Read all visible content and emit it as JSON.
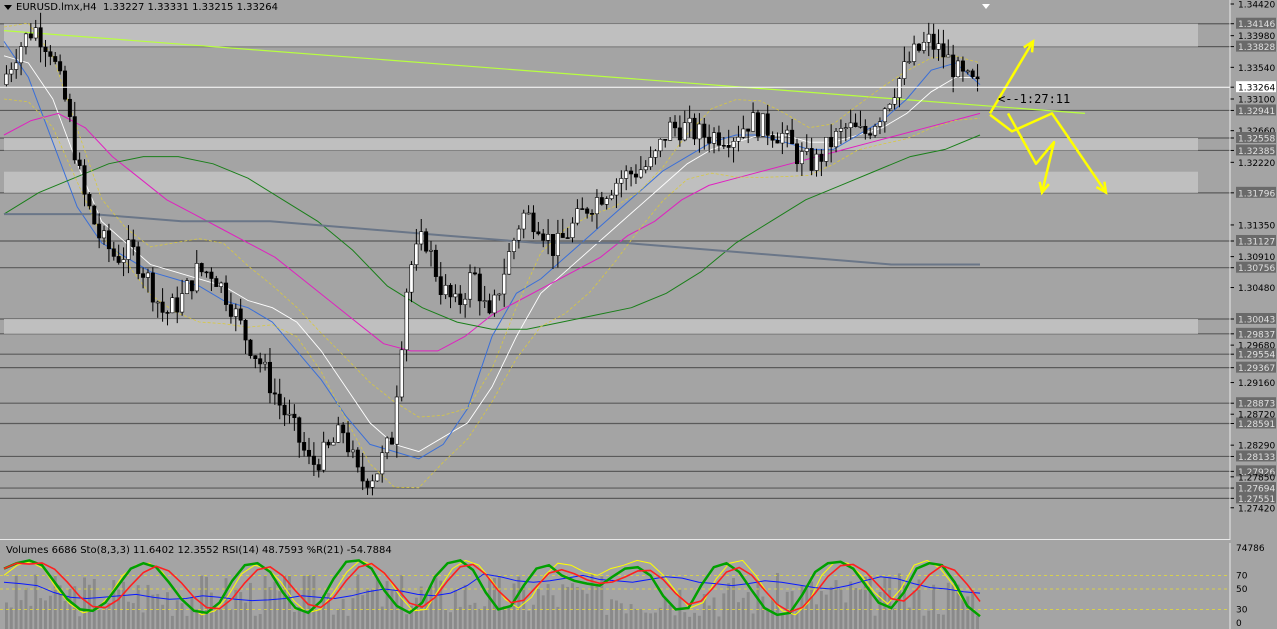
{
  "header": {
    "symbol": "EURUSD.lmx,H4",
    "quote": "1.33227 1.33331 1.33215 1.33264"
  },
  "countdown": "<--1:27:11",
  "current_price": "1.33264",
  "indicators_label": "Volumes 6686  Sto(8,3,3) 11.6402 12.3552  RSI(14) 48.7593  %R(21) -54.7884",
  "colors": {
    "background": "#a4a4a4",
    "bull_candle": "#ffffff",
    "bear_candle": "#000000",
    "ma_fast_white": "#ffffff",
    "ma_blue": "#3a6fd8",
    "ma_magenta": "#e020c0",
    "ma_green": "#1a7f1a",
    "ma_slow_gray": "#6a7688",
    "bollinger": "#d8c840",
    "trendline": "#b8ff40",
    "arrows": "#ffff00",
    "stoch_main": "#00a000",
    "stoch_signal": "#ff2020",
    "rsi": "#0a1aff",
    "williams": "#ffff00"
  },
  "chart_data": [
    {
      "type": "line",
      "title": "EURUSD.lmx,H4",
      "series_kind": "candlestick",
      "ylim": [
        1.27,
        1.3442
      ],
      "y_axis_labels": [
        "1.34420",
        "1.34146",
        "1.33980",
        "1.33828",
        "1.33540",
        "1.33264",
        "1.33100",
        "1.32941",
        "1.32660",
        "1.32558",
        "1.32385",
        "1.32220",
        "1.31796",
        "1.31350",
        "1.31127",
        "1.30910",
        "1.30756",
        "1.30480",
        "1.30043",
        "1.29837",
        "1.29680",
        "1.29554",
        "1.29367",
        "1.29160",
        "1.28873",
        "1.28720",
        "1.28591",
        "1.28290",
        "1.28133",
        "1.27926",
        "1.27850",
        "1.27694",
        "1.27551",
        "1.27420"
      ],
      "horizontal_levels": [
        1.34146,
        1.33828,
        1.32941,
        1.32558,
        1.32385,
        1.31796,
        1.31127,
        1.30756,
        1.30043,
        1.29837,
        1.29554,
        1.29367,
        1.28873,
        1.28591,
        1.28133,
        1.27926,
        1.27694,
        1.27551
      ],
      "shaded_zones": [
        [
          1.33828,
          1.34146
        ],
        [
          1.32385,
          1.32558
        ],
        [
          1.31796,
          1.3209
        ],
        [
          1.29837,
          1.30043
        ]
      ],
      "key_path": [
        1.333,
        1.338,
        1.341,
        1.338,
        1.33,
        1.318,
        1.312,
        1.309,
        1.31,
        1.306,
        1.301,
        1.303,
        1.307,
        1.307,
        1.303,
        1.298,
        1.294,
        1.289,
        1.285,
        1.28,
        1.282,
        1.285,
        1.278,
        1.279,
        1.284,
        1.307,
        1.312,
        1.305,
        1.302,
        1.307,
        1.3,
        1.308,
        1.315,
        1.314,
        1.31,
        1.313,
        1.316,
        1.318,
        1.32,
        1.321,
        1.322,
        1.327,
        1.327,
        1.326,
        1.326,
        1.326,
        1.328,
        1.327,
        1.326,
        1.323,
        1.322,
        1.325,
        1.327,
        1.326,
        1.329,
        1.333,
        1.337,
        1.339,
        1.337,
        1.334,
        1.3326
      ],
      "moving_averages": [
        {
          "name": "MA white",
          "values": [
            1.337,
            1.336,
            1.331,
            1.322,
            1.314,
            1.311,
            1.308,
            1.307,
            1.306,
            1.305,
            1.303,
            1.302,
            1.3,
            1.296,
            1.291,
            1.286,
            1.283,
            1.282,
            1.284,
            1.286,
            1.291,
            1.298,
            1.304,
            1.307,
            1.31,
            1.313,
            1.316,
            1.319,
            1.322,
            1.324,
            1.325,
            1.326,
            1.326,
            1.325,
            1.325,
            1.326,
            1.327,
            1.329,
            1.332,
            1.334,
            1.334
          ]
        },
        {
          "name": "MA blue",
          "values": [
            1.339,
            1.334,
            1.325,
            1.316,
            1.311,
            1.309,
            1.307,
            1.306,
            1.305,
            1.303,
            1.302,
            1.3,
            1.296,
            1.292,
            1.287,
            1.283,
            1.282,
            1.281,
            1.283,
            1.288,
            1.298,
            1.304,
            1.306,
            1.309,
            1.312,
            1.315,
            1.318,
            1.321,
            1.323,
            1.325,
            1.326,
            1.326,
            1.325,
            1.324,
            1.324,
            1.326,
            1.328,
            1.331,
            1.335,
            1.336,
            1.333
          ]
        },
        {
          "name": "MA magenta",
          "values": [
            1.326,
            1.328,
            1.329,
            1.327,
            1.323,
            1.32,
            1.317,
            1.315,
            1.313,
            1.311,
            1.309,
            1.306,
            1.303,
            1.3,
            1.297,
            1.296,
            1.296,
            1.298,
            1.301,
            1.303,
            1.305,
            1.307,
            1.309,
            1.312,
            1.314,
            1.317,
            1.319,
            1.32,
            1.321,
            1.322,
            1.323,
            1.324,
            1.325,
            1.326,
            1.327,
            1.328,
            1.329
          ]
        },
        {
          "name": "MA green",
          "values": [
            1.315,
            1.318,
            1.32,
            1.322,
            1.323,
            1.323,
            1.322,
            1.32,
            1.317,
            1.314,
            1.31,
            1.305,
            1.302,
            1.3,
            1.299,
            1.299,
            1.3,
            1.301,
            1.302,
            1.304,
            1.307,
            1.311,
            1.314,
            1.317,
            1.319,
            1.321,
            1.323,
            1.324,
            1.326
          ]
        },
        {
          "name": "MA gray",
          "values": [
            1.315,
            1.315,
            1.314,
            1.314,
            1.313,
            1.312,
            1.311,
            1.311,
            1.31,
            1.309,
            1.308,
            1.308
          ]
        }
      ],
      "trendline": {
        "from": [
          0,
          1.3405
        ],
        "to": [
          1,
          1.329
        ]
      },
      "projection_arrows": [
        {
          "points": [
            1.329,
            1.339
          ]
        },
        {
          "points": [
            1.329,
            1.322,
            1.325,
            1.318
          ]
        },
        {
          "points": [
            1.3288,
            1.3265,
            1.329,
            1.318
          ]
        }
      ]
    },
    {
      "type": "line",
      "title": "Volumes  Sto(8,3,3)  RSI(14)  %R(21)",
      "ylim": [
        0,
        100
      ],
      "y_axis_labels": [
        "74786",
        "70",
        "50",
        "30",
        "0"
      ],
      "levels": [
        70,
        50,
        20
      ],
      "stoch_main": [
        80,
        88,
        92,
        85,
        60,
        35,
        20,
        18,
        30,
        55,
        80,
        88,
        82,
        60,
        35,
        18,
        15,
        30,
        62,
        85,
        88,
        75,
        45,
        22,
        15,
        32,
        65,
        90,
        92,
        80,
        48,
        25,
        15,
        30,
        68,
        88,
        92,
        78,
        45,
        20,
        25,
        55,
        80,
        85,
        70,
        62,
        58,
        55,
        68,
        80,
        82,
        70,
        40,
        20,
        22,
        55,
        82,
        88,
        75,
        48,
        22,
        12,
        15,
        42,
        75,
        88,
        90,
        80,
        55,
        30,
        22,
        45,
        80,
        88,
        85,
        60,
        25,
        10
      ],
      "rsi": [
        60,
        58,
        55,
        45,
        38,
        36,
        38,
        40,
        42,
        38,
        35,
        36,
        40,
        38,
        35,
        33,
        34,
        36,
        40,
        38,
        36,
        40,
        46,
        50,
        47,
        42,
        40,
        44,
        55,
        72,
        68,
        62,
        60,
        62,
        66,
        70,
        64,
        62,
        60,
        64,
        68,
        66,
        60,
        58,
        55,
        58,
        62,
        60,
        56,
        52,
        50,
        55,
        62,
        68,
        65,
        58,
        52,
        50,
        46,
        44
      ],
      "williams": [
        70,
        85,
        90,
        80,
        50,
        28,
        15,
        20,
        40,
        70,
        85,
        88,
        75,
        48,
        25,
        12,
        18,
        40,
        72,
        85,
        80,
        60,
        32,
        15,
        20,
        45,
        75,
        92,
        85,
        70,
        40,
        18,
        20,
        50,
        80,
        92,
        85,
        62,
        35,
        22,
        38,
        70,
        88,
        85,
        75,
        70,
        80,
        85,
        92,
        88,
        70,
        45,
        22,
        30,
        65,
        88,
        92,
        70,
        40,
        18,
        12,
        30,
        70,
        90,
        88,
        70,
        45,
        28,
        50,
        85,
        92,
        80,
        55,
        25,
        12
      ]
    }
  ]
}
